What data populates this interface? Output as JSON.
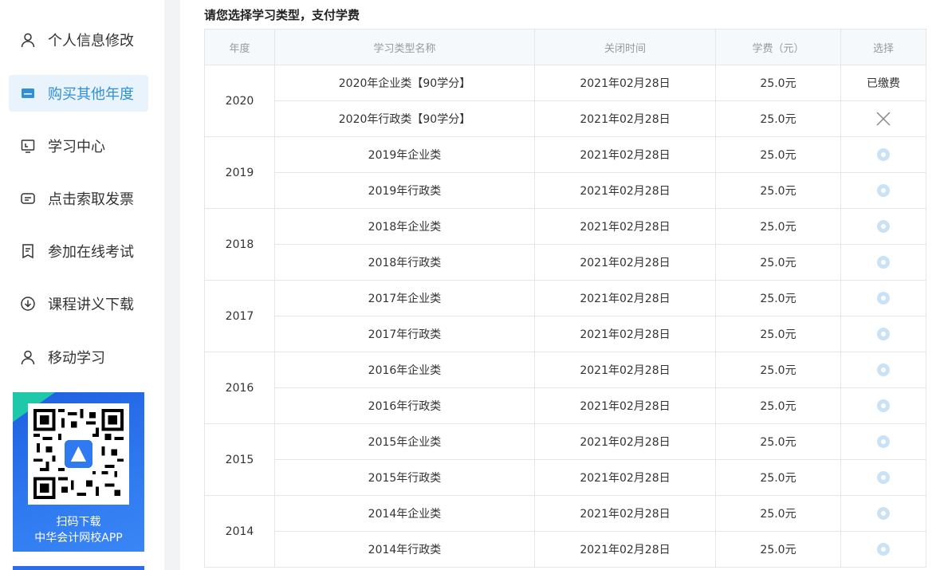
{
  "sidebar": {
    "items": [
      {
        "label": "个人信息修改",
        "icon": "user-icon",
        "active": false
      },
      {
        "label": "购买其他年度",
        "icon": "card-icon",
        "active": true
      },
      {
        "label": "学习中心",
        "icon": "monitor-icon",
        "active": false
      },
      {
        "label": "点击索取发票",
        "icon": "invoice-icon",
        "active": false
      },
      {
        "label": "参加在线考试",
        "icon": "exam-icon",
        "active": false
      },
      {
        "label": "课程讲义下载",
        "icon": "download-icon",
        "active": false
      },
      {
        "label": "移动学习",
        "icon": "user-icon",
        "active": false
      }
    ],
    "promo": {
      "line1": "扫码下载",
      "line2": "中华会计网校APP"
    }
  },
  "main": {
    "heading": "请您选择学习类型，支付学费",
    "columns": [
      "年度",
      "学习类型名称",
      "关闭时间",
      "学费（元）",
      "选择"
    ],
    "groups": [
      {
        "year": "2020",
        "rows": [
          {
            "name": "2020年企业类【90学分】",
            "close": "2021年02月28日",
            "fee": "25.0元",
            "select": "已缴费"
          },
          {
            "name": "2020年行政类【90学分】",
            "close": "2021年02月28日",
            "fee": "25.0元",
            "select": "x"
          }
        ]
      },
      {
        "year": "2019",
        "rows": [
          {
            "name": "2019年企业类",
            "close": "2021年02月28日",
            "fee": "25.0元",
            "select": "radio"
          },
          {
            "name": "2019年行政类",
            "close": "2021年02月28日",
            "fee": "25.0元",
            "select": "radio"
          }
        ]
      },
      {
        "year": "2018",
        "rows": [
          {
            "name": "2018年企业类",
            "close": "2021年02月28日",
            "fee": "25.0元",
            "select": "radio"
          },
          {
            "name": "2018年行政类",
            "close": "2021年02月28日",
            "fee": "25.0元",
            "select": "radio"
          }
        ]
      },
      {
        "year": "2017",
        "rows": [
          {
            "name": "2017年企业类",
            "close": "2021年02月28日",
            "fee": "25.0元",
            "select": "radio"
          },
          {
            "name": "2017年行政类",
            "close": "2021年02月28日",
            "fee": "25.0元",
            "select": "radio"
          }
        ]
      },
      {
        "year": "2016",
        "rows": [
          {
            "name": "2016年企业类",
            "close": "2021年02月28日",
            "fee": "25.0元",
            "select": "radio"
          },
          {
            "name": "2016年行政类",
            "close": "2021年02月28日",
            "fee": "25.0元",
            "select": "radio"
          }
        ]
      },
      {
        "year": "2015",
        "rows": [
          {
            "name": "2015年企业类",
            "close": "2021年02月28日",
            "fee": "25.0元",
            "select": "radio"
          },
          {
            "name": "2015年行政类",
            "close": "2021年02月28日",
            "fee": "25.0元",
            "select": "radio"
          }
        ]
      },
      {
        "year": "2014",
        "rows": [
          {
            "name": "2014年企业类",
            "close": "2021年02月28日",
            "fee": "25.0元",
            "select": "radio"
          },
          {
            "name": "2014年行政类",
            "close": "2021年02月28日",
            "fee": "25.0元",
            "select": "radio"
          }
        ]
      }
    ]
  },
  "colors": {
    "accent": "#2f8fd8",
    "active_bg": "#e8f3fc",
    "radio": "#c9e2f6",
    "promo": "#2f7af0"
  }
}
